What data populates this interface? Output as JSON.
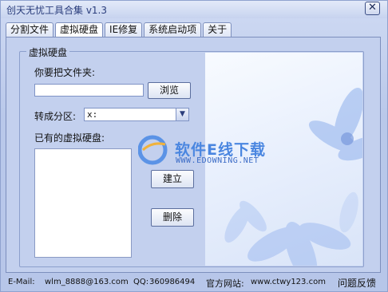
{
  "window": {
    "title": "创天无忧工具合集 v1.3",
    "close_label": "✕"
  },
  "tabs": [
    {
      "label": "分割文件"
    },
    {
      "label": "虚拟硬盘"
    },
    {
      "label": "IE修复"
    },
    {
      "label": "系统启动项"
    },
    {
      "label": "关于"
    }
  ],
  "virtual_disk": {
    "group_title": "虚拟硬盘",
    "folder_label": "你要把文件夹:",
    "folder_value": "",
    "browse_label": "浏览",
    "convert_label": "转成分区:",
    "drive_selected": "x:",
    "existing_label": "已有的虚拟硬盘:",
    "create_label": "建立",
    "delete_label": "删除"
  },
  "watermark": {
    "name": "软件E线下载",
    "url": "WWW.EDOWNING.NET"
  },
  "footer": {
    "email_label": "E-Mail:",
    "email": "wlm_8888@163.com",
    "qq_label": "QQ:",
    "qq": "360986494",
    "site_label": "官方网站:",
    "site": "www.ctwy123.com",
    "feedback": "问题反馈"
  },
  "colors": {
    "window_bg": "#b9c8ea",
    "link": "#1c2fbd",
    "watermark": "#4a86e0"
  }
}
